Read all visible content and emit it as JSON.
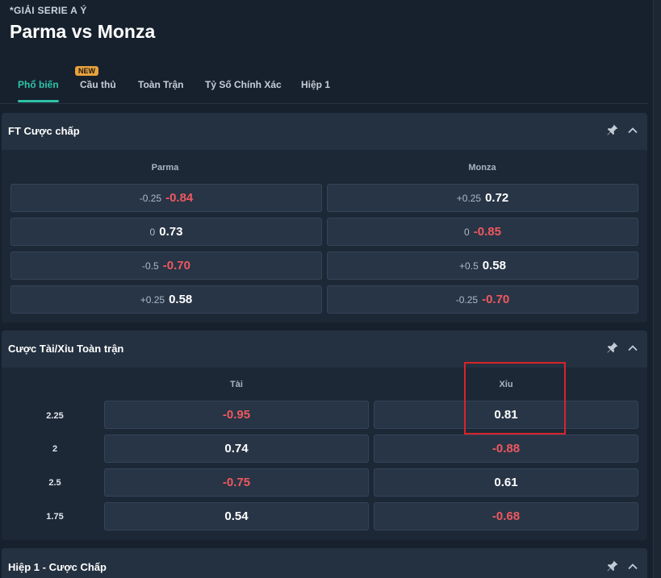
{
  "header": {
    "league": "*GIẢI SERIE A Ý",
    "match": "Parma vs Monza"
  },
  "tabs": [
    {
      "label": "Phổ biến"
    },
    {
      "label": "Cầu thủ",
      "badge": "NEW"
    },
    {
      "label": "Toàn Trận"
    },
    {
      "label": "Tỷ Số Chính Xác"
    },
    {
      "label": "Hiệp 1"
    }
  ],
  "handicap": {
    "title": "FT Cược chấp",
    "home": "Parma",
    "away": "Monza",
    "rows": [
      {
        "home_hcp": "-0.25",
        "home_price": "-0.84",
        "away_hcp": "+0.25",
        "away_price": "0.72"
      },
      {
        "home_hcp": "0",
        "home_price": "0.73",
        "away_hcp": "0",
        "away_price": "-0.85"
      },
      {
        "home_hcp": "-0.5",
        "home_price": "-0.70",
        "away_hcp": "+0.5",
        "away_price": "0.58"
      },
      {
        "home_hcp": "+0.25",
        "home_price": "0.58",
        "away_hcp": "-0.25",
        "away_price": "-0.70"
      }
    ]
  },
  "overunder": {
    "title": "Cược Tài/Xỉu Toàn trận",
    "over": "Tài",
    "under": "Xỉu",
    "rows": [
      {
        "line": "2.25",
        "over": "-0.95",
        "under": "0.81"
      },
      {
        "line": "2",
        "over": "0.74",
        "under": "-0.88"
      },
      {
        "line": "2.5",
        "over": "-0.75",
        "under": "0.61"
      },
      {
        "line": "1.75",
        "over": "0.54",
        "under": "-0.68"
      }
    ]
  },
  "first_half": {
    "title": "Hiệp 1 - Cược Chấp"
  },
  "colors": {
    "accent": "#2fc3a9",
    "negative": "#f0585f",
    "highlight": "#d8242a",
    "badge": "#e8a23a"
  },
  "icons": {
    "pin": "pin-icon",
    "collapse": "chevron-up-icon"
  }
}
